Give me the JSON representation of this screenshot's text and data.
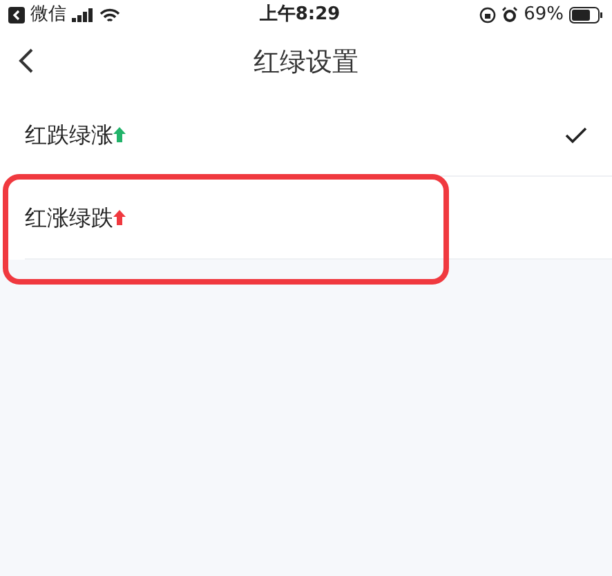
{
  "status_bar": {
    "back_app": "微信",
    "time": "上午8:29",
    "battery": "69%"
  },
  "nav": {
    "title": "红绿设置"
  },
  "options": [
    {
      "label": "红跌绿涨",
      "color": "#22b36a",
      "selected": true,
      "highlighted": false
    },
    {
      "label": "红涨绿跌",
      "color": "#f0393f",
      "selected": false,
      "highlighted": true
    }
  ]
}
